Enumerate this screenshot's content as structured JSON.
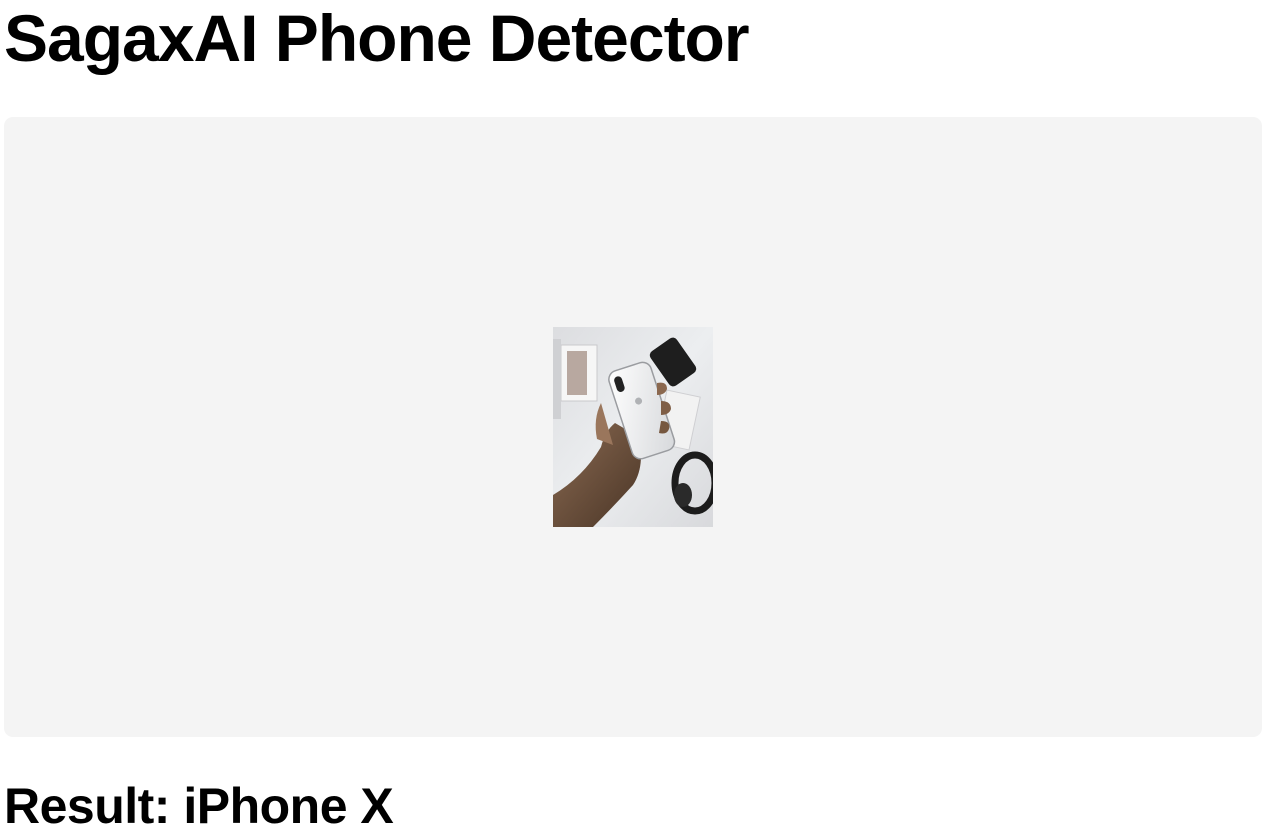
{
  "page": {
    "title": "SagaxAI Phone Detector"
  },
  "upload": {
    "preview_alt": "uploaded phone photo"
  },
  "result": {
    "prefix": "Result: ",
    "value": "iPhone X"
  }
}
